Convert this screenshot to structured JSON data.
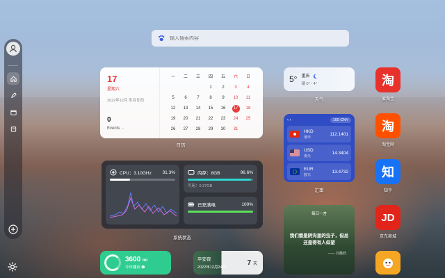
{
  "search": {
    "placeholder": "输入搜索内容"
  },
  "calendar": {
    "day": "17",
    "weekday": "星期六",
    "lunar": "2022年12月  冬月廿四",
    "events_count": "0",
    "events_label": "Events",
    "weekday_headers": [
      "一",
      "二",
      "三",
      "四",
      "五",
      "六",
      "日"
    ],
    "rows": [
      [
        "",
        "",
        "",
        "1",
        "2",
        "3",
        "4"
      ],
      [
        "5",
        "6",
        "7",
        "8",
        "9",
        "10",
        "11"
      ],
      [
        "12",
        "13",
        "14",
        "15",
        "16",
        "17",
        "18"
      ],
      [
        "19",
        "20",
        "21",
        "22",
        "23",
        "24",
        "25"
      ],
      [
        "26",
        "27",
        "28",
        "29",
        "30",
        "31",
        ""
      ]
    ],
    "today": "17",
    "label": "日历"
  },
  "weather": {
    "temp": "5°",
    "city": "重庆",
    "desc": "晴  0° - 4°",
    "label": "天气"
  },
  "exchange": {
    "arrows": "‹  ›",
    "base": "100 CNY",
    "rows": [
      {
        "code": "HKD",
        "name": "港币",
        "value": "112.1401"
      },
      {
        "code": "USD",
        "name": "美元",
        "value": "14.3404"
      },
      {
        "code": "EUR",
        "name": "欧元",
        "value": "13.4732"
      }
    ],
    "label": "汇率"
  },
  "system": {
    "cpu_label": "CPU：3.10GHz",
    "cpu_pct": "31.3%",
    "cpu_value": 0.313,
    "mem_label": "内存：8GB",
    "mem_pct": "96.6%",
    "mem_value": 0.966,
    "mem_available": "可用：0.27GB",
    "bat_label": "已充满电",
    "bat_pct": "100%",
    "bat_value": 1.0,
    "label": "系统状态"
  },
  "quote": {
    "title": "每日一言",
    "text": "我们都是阴沟里的虫子，但总还是得有人仰望",
    "author": "—— 刘慈欣"
  },
  "steps": {
    "count": "3600",
    "unit": "ml",
    "sub": "今日建议"
  },
  "countdown": {
    "title": "平安夜",
    "date": "2022年12月24日",
    "days": "7",
    "days_unit": "天"
  },
  "apps": [
    {
      "name": "爱淘宝",
      "glyph": "淘",
      "color": "#e8312a"
    },
    {
      "name": "淘宝网",
      "glyph": "淘",
      "color": "#ff5000"
    },
    {
      "name": "知乎",
      "glyph": "知",
      "color": "#1772f6"
    },
    {
      "name": "京东商城",
      "glyph": "JD",
      "color": "#e1251b"
    },
    {
      "name": "",
      "glyph": "",
      "color": "#f5a623"
    }
  ],
  "colors": {
    "accent_red": "#e83a3a",
    "fx_blue": "#2f4cc4",
    "cyan": "#2ed6d0",
    "green": "#5ee05a"
  }
}
